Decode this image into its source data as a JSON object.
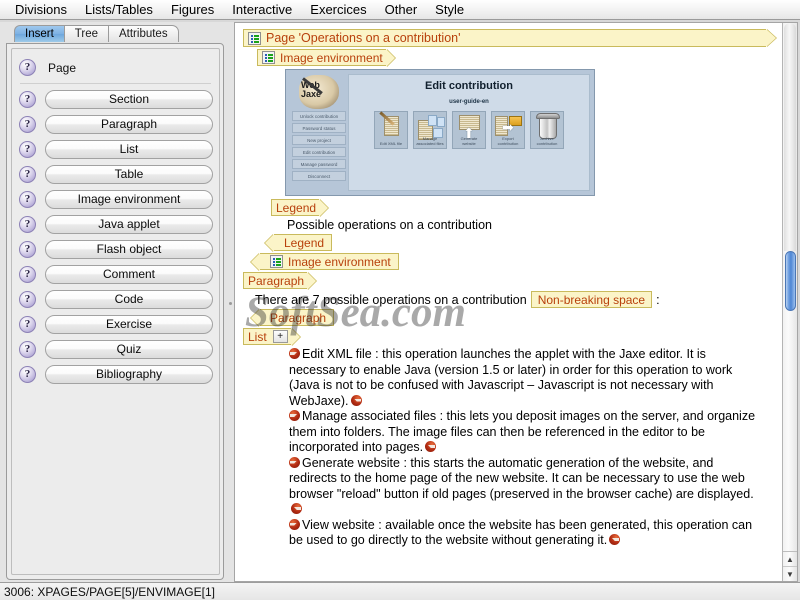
{
  "menubar": {
    "items": [
      {
        "label": "Divisions"
      },
      {
        "label": "Lists/Tables"
      },
      {
        "label": "Figures"
      },
      {
        "label": "Interactive"
      },
      {
        "label": "Exercices"
      },
      {
        "label": "Other"
      },
      {
        "label": "Style"
      }
    ]
  },
  "sidebar": {
    "tabs": [
      {
        "label": "Insert",
        "active": true
      },
      {
        "label": "Tree",
        "active": false
      },
      {
        "label": "Attributes",
        "active": false
      }
    ],
    "help_glyph": "?",
    "context": {
      "label": "Page"
    },
    "items": [
      {
        "label": "Section"
      },
      {
        "label": "Paragraph"
      },
      {
        "label": "List"
      },
      {
        "label": "Table"
      },
      {
        "label": "Image environment"
      },
      {
        "label": "Java applet"
      },
      {
        "label": "Flash object"
      },
      {
        "label": "Comment"
      },
      {
        "label": "Code"
      },
      {
        "label": "Exercise"
      },
      {
        "label": "Quiz"
      },
      {
        "label": "Bibliography"
      }
    ]
  },
  "document": {
    "page_tag": "Page 'Operations on  a contribution'",
    "image_env_open": "Image environment",
    "image_env_close": "Image environment",
    "legend_open": "Legend",
    "legend_close": "Legend",
    "legend_text": "Possible operations on a contribution",
    "paragraph_open": "Paragraph",
    "paragraph_close": "Paragraph",
    "paragraph_text_before": "There are 7 possible operations on a contribution",
    "nbsp_tag": "Non-breaking space",
    "paragraph_text_after": ":",
    "list_open": "List",
    "list_plus": "+",
    "list_items": [
      "Edit XML file : this operation launches the applet with the Jaxe editor. It is necessary to enable Java (version 1.5 or later) in order for this operation to work (Java is not to be confused with Javascript – Javascript is not necessary with WebJaxe).",
      "Manage associated files : this lets you deposit images on the server, and organize them into folders. The image files can then be referenced in the editor to be incorporated into pages.",
      "Generate website : this starts the automatic generation of the website, and redirects to the home page of the new website. It can be necessary to use the web browser \"reload\" button if old pages (preserved in the browser cache) are displayed.",
      "View website : available once the website has been generated, this operation can be used to go directly to the website without generating it."
    ]
  },
  "embedded_image": {
    "watermark_logo": "WebJaxe",
    "logo_text": "Web Jaxe",
    "title": "Edit contribution",
    "subtitle": "user-guide-en",
    "side_buttons": [
      "Unlock contribution",
      "Password status",
      "New project",
      "Edit contribution",
      "Manage password",
      "Disconnect"
    ],
    "icons": [
      {
        "caption": "Edit XML file"
      },
      {
        "caption": "Manage associated files"
      },
      {
        "caption": "Generate website"
      },
      {
        "caption": "Export contribution"
      },
      {
        "caption": "Archive contribution"
      }
    ]
  },
  "watermark": {
    "text": "SoftSea.com"
  },
  "statusbar": {
    "text": "3006: XPAGES/PAGE[5]/ENVIMAGE[1]"
  },
  "scroll_arrows": {
    "up": "▲",
    "down": "▼"
  },
  "colors": {
    "tag_bg": "#fbf4c8",
    "tag_border": "#c9ba5c",
    "tag_text": "#b8400c",
    "tab_active": "#7fb2e3",
    "scroll_thumb": "#4e86d4"
  }
}
